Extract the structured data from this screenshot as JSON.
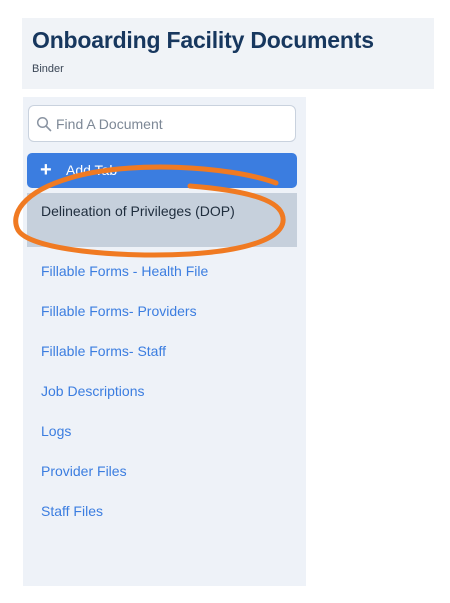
{
  "header": {
    "title": "Onboarding Facility Documents",
    "subtitle": "Binder"
  },
  "sidebar": {
    "search": {
      "placeholder": "Find A Document"
    },
    "add_tab_label": "Add Tab",
    "selected_item": "Delineation of Privileges (DOP)",
    "items": [
      {
        "label": "Fillable Forms - Health File"
      },
      {
        "label": "Fillable Forms- Providers"
      },
      {
        "label": "Fillable Forms- Staff"
      },
      {
        "label": "Job Descriptions"
      },
      {
        "label": "Logs"
      },
      {
        "label": "Provider Files"
      },
      {
        "label": "Staff Files"
      }
    ]
  },
  "colors": {
    "title": "#17375e",
    "accent": "#3b7de0",
    "selected_bg": "#c6d0dc",
    "annotation": "#f07a22"
  }
}
